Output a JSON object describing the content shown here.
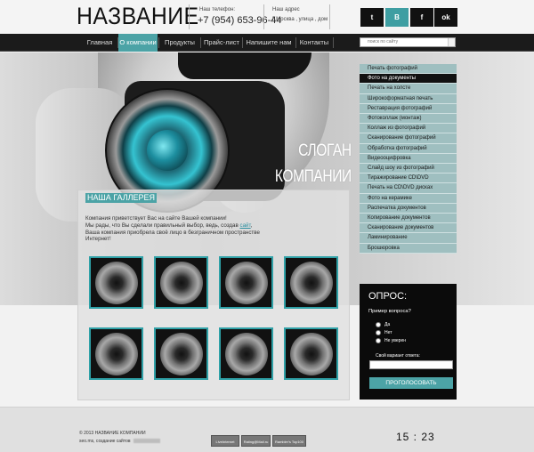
{
  "header": {
    "logo": "НАЗВАНИЕ",
    "phone_label": "Наш телефон:",
    "phone": "+7 (954) 653-96-44",
    "address_label": "Наш адрес",
    "address": "Г.Москва , улица , дом",
    "social": [
      {
        "name": "twitter",
        "glyph": "t"
      },
      {
        "name": "vk",
        "glyph": "B"
      },
      {
        "name": "facebook",
        "glyph": "f"
      },
      {
        "name": "odnoklassniki",
        "glyph": "ok"
      }
    ]
  },
  "nav": {
    "items": [
      "Главная",
      "О компании",
      "Продукты",
      "Прайс-лист",
      "Напишите нам",
      "Контакты"
    ],
    "active_index": 1,
    "search_placeholder": "поиск по сайту"
  },
  "hero": {
    "slogan_line1": "СЛОГАН",
    "slogan_line2": "КОМПАНИИ"
  },
  "main": {
    "gallery_title": "НАША ГАЛЛЕРЕЯ",
    "intro_line1": "Компания приветствует Вас на сайте Вашей компании!",
    "intro_part1": "Мы рады, что Вы сделали правильный выбор, ведь, создав ",
    "intro_link": "сайт",
    "intro_part2": ", Ваша компания приобрела своё лицо в безграничном пространстве Интернет!"
  },
  "sidebar": {
    "items": [
      "Печать фотографий",
      "Фото на документы",
      "Печать на холсте",
      "Широкоформатная печать",
      "Реставрация фотографий",
      "Фотоколлаж (монтаж)",
      "Коллаж из фотографий",
      "Сканирование фотографий",
      "Обработка фотографий",
      "Видеооцифровка",
      "Слайд шоу из фотографий",
      "Тиражирование CD\\DVD",
      "Печать на CD\\DVD дисках",
      "Фото на керамике",
      "Распечатка документов",
      "Копирование документов",
      "Сканирование документов",
      "Ламинирование",
      "Брошюровка"
    ],
    "active_index": 1
  },
  "poll": {
    "title": "ОПРОС:",
    "question": "Пример вопроса?",
    "options": [
      "Да",
      "Нет",
      "Не уверен"
    ],
    "own_label": "Свой вариант ответа:",
    "vote_button": "ПРОГОЛОСОВАТЬ"
  },
  "footer": {
    "copyright": "© 2013 НАЗВАНИЕ КОМПАНИИ",
    "made_by": "seo.ms, создание сайтов",
    "clock": "15 : 23",
    "counters": [
      "LiveInternet",
      "Rating@Mail.ru",
      "Rambler's Top100"
    ]
  },
  "colors": {
    "accent": "#4ca3a6",
    "sidebar_bg": "#9fbfc0",
    "nav_bg": "#1b1b1b"
  }
}
